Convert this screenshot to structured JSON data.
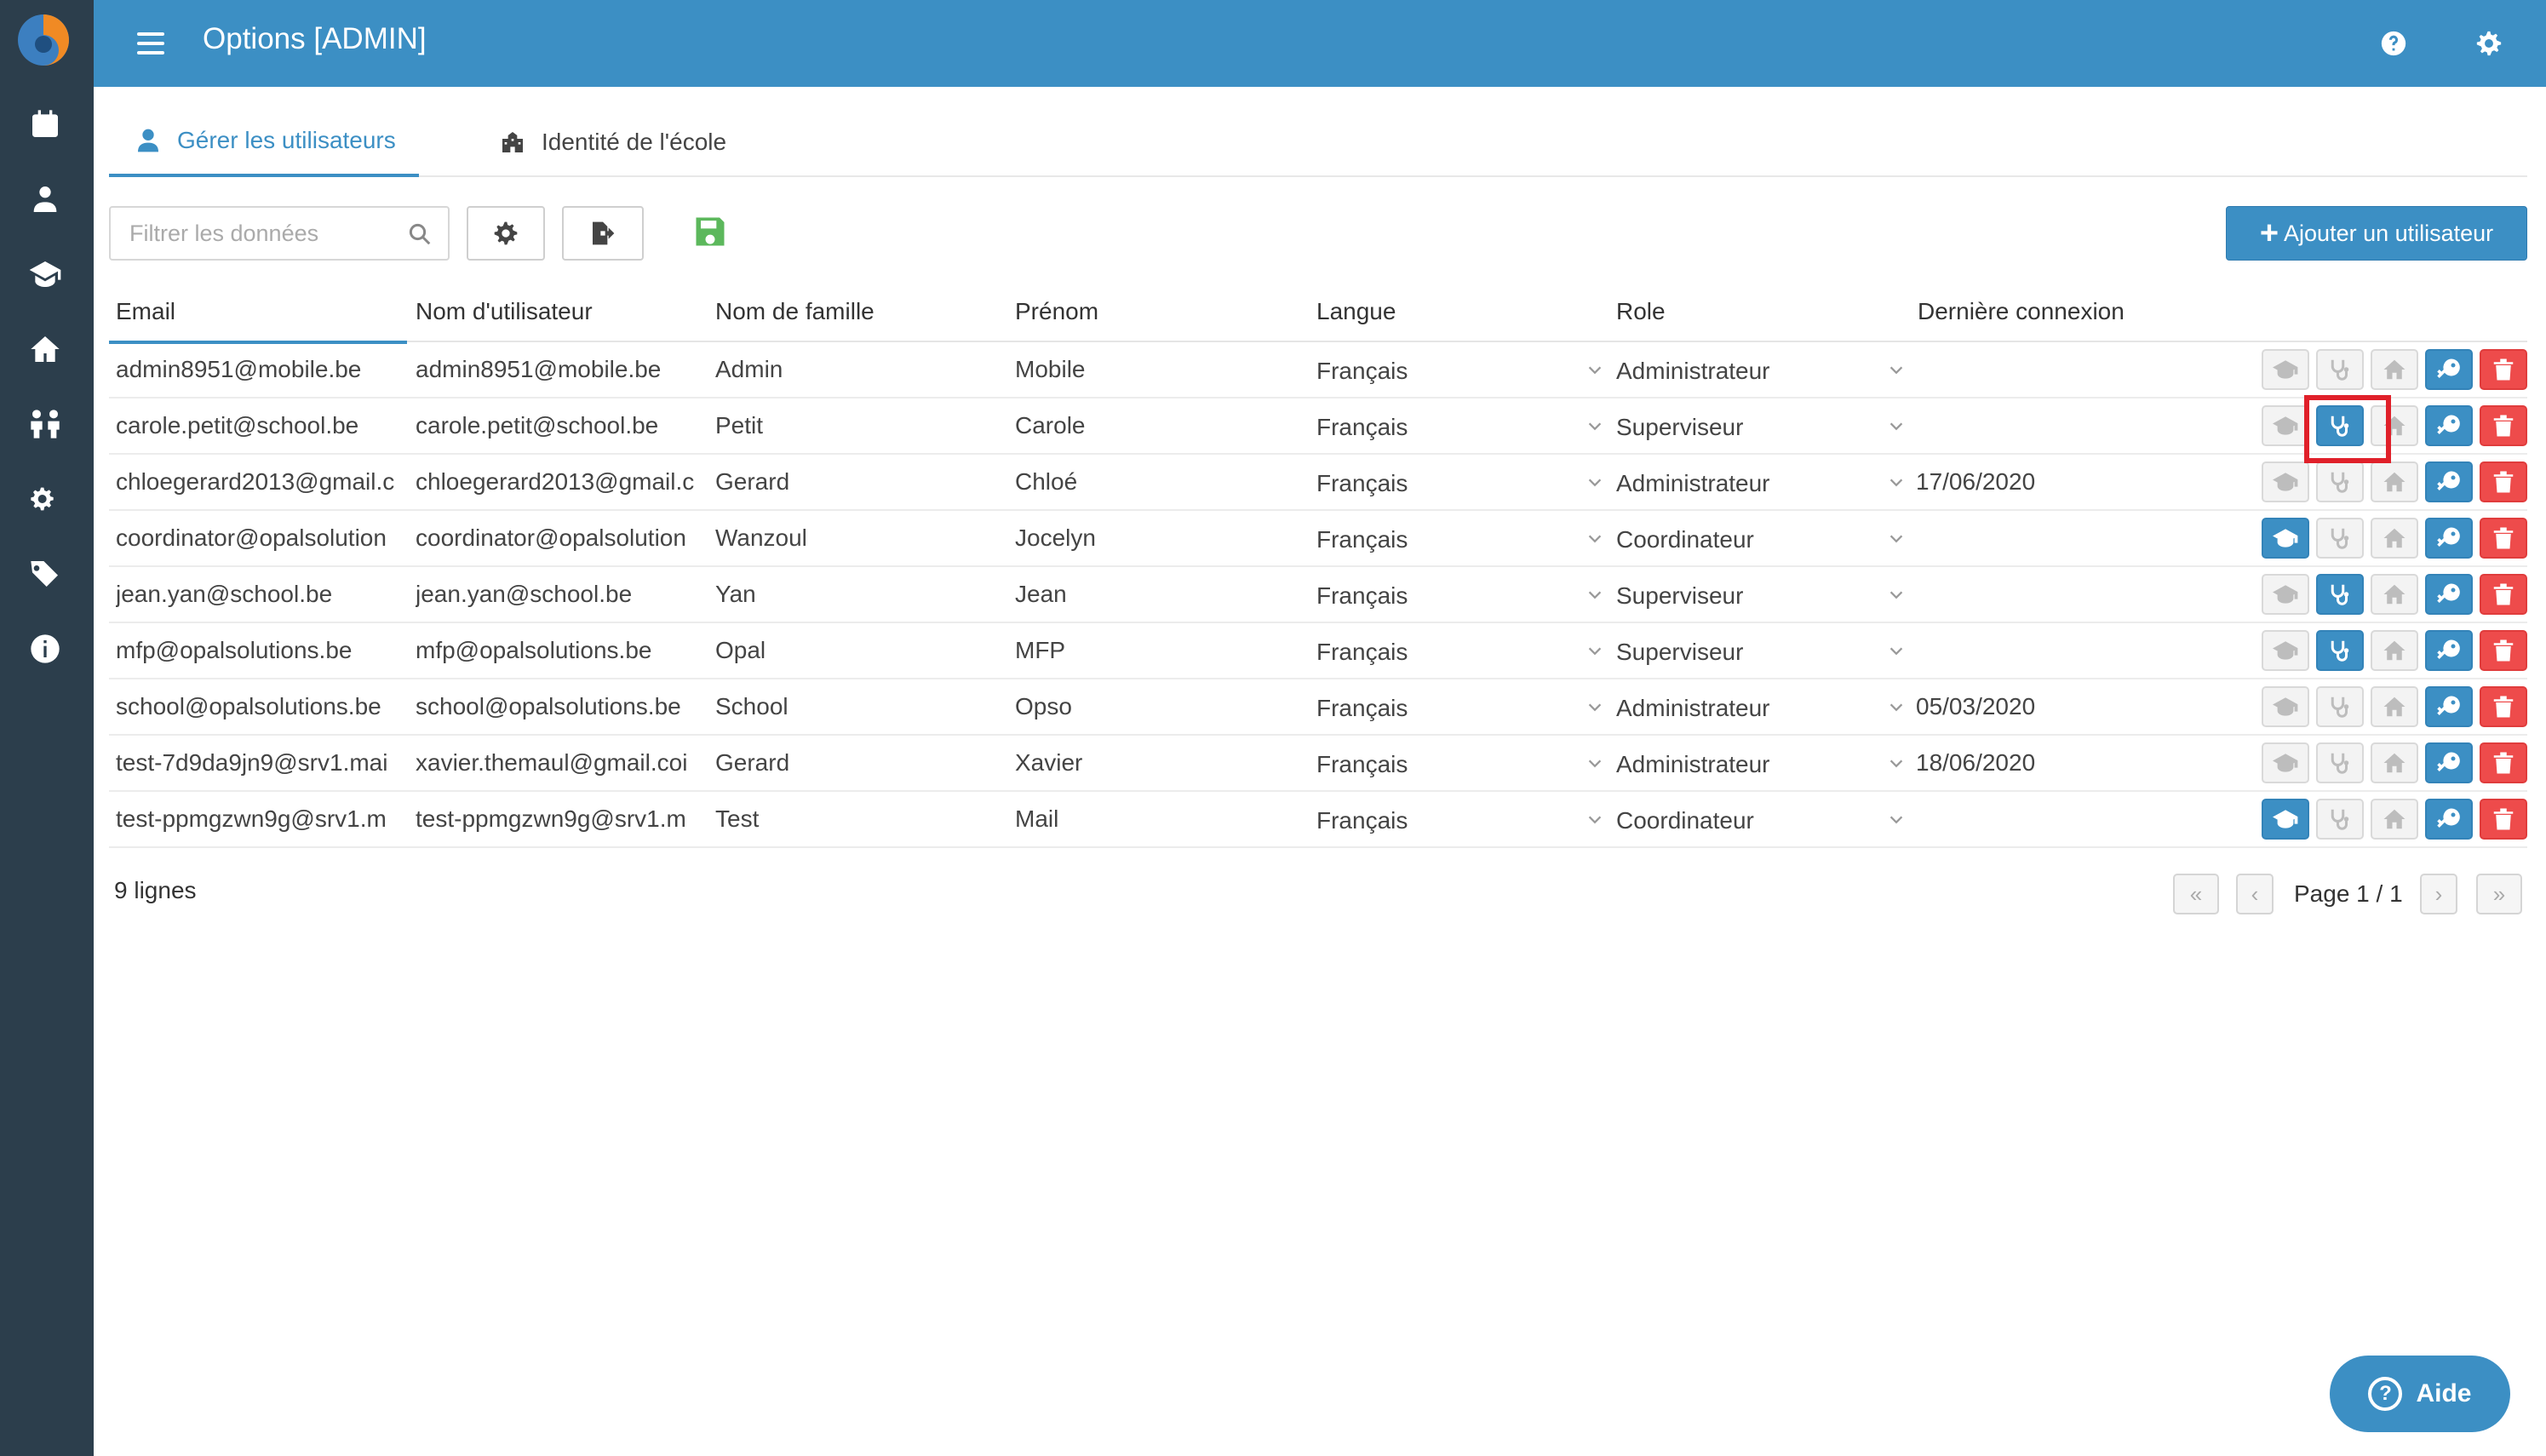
{
  "header": {
    "title": "Options [ADMIN]",
    "help_icon": "question-circle-icon",
    "settings_icon": "gear-icon"
  },
  "sidebar": {
    "logo": "app-logo",
    "items": [
      {
        "icon": "calendar-icon"
      },
      {
        "icon": "teacher-icon"
      },
      {
        "icon": "graduation-cap-icon"
      },
      {
        "icon": "home-icon"
      },
      {
        "icon": "people-icon"
      },
      {
        "icon": "gears-icon"
      },
      {
        "icon": "tags-icon"
      },
      {
        "icon": "info-icon"
      }
    ]
  },
  "tabs": [
    {
      "label": "Gérer les utilisateurs",
      "icon": "user-icon",
      "active": true
    },
    {
      "label": "Identité de l'école",
      "icon": "school-icon",
      "active": false
    }
  ],
  "toolbar": {
    "search_placeholder": "Filtrer les données",
    "add_label": "Ajouter un utilisateur"
  },
  "table": {
    "headers": [
      "Email",
      "Nom d'utilisateur",
      "Nom de famille",
      "Prénom",
      "Langue",
      "Role",
      "Dernière connexion"
    ],
    "rows": [
      {
        "email": "admin8951@mobile.be",
        "username": "admin8951@mobile.be",
        "lastname": "Admin",
        "firstname": "Mobile",
        "lang": "Français",
        "role": "Administrateur",
        "last": "",
        "active": [
          false,
          false,
          false
        ]
      },
      {
        "email": "carole.petit@school.be",
        "username": "carole.petit@school.be",
        "lastname": "Petit",
        "firstname": "Carole",
        "lang": "Français",
        "role": "Superviseur",
        "last": "",
        "active": [
          false,
          true,
          false
        ]
      },
      {
        "email": "chloegerard2013@gmail.c",
        "username": "chloegerard2013@gmail.c",
        "lastname": "Gerard",
        "firstname": "Chloé",
        "lang": "Français",
        "role": "Administrateur",
        "last": "17/06/2020",
        "active": [
          false,
          false,
          false
        ]
      },
      {
        "email": "coordinator@opalsolution",
        "username": "coordinator@opalsolution",
        "lastname": "Wanzoul",
        "firstname": "Jocelyn",
        "lang": "Français",
        "role": "Coordinateur",
        "last": "",
        "active": [
          true,
          false,
          false
        ]
      },
      {
        "email": "jean.yan@school.be",
        "username": "jean.yan@school.be",
        "lastname": "Yan",
        "firstname": "Jean",
        "lang": "Français",
        "role": "Superviseur",
        "last": "",
        "active": [
          false,
          true,
          false
        ]
      },
      {
        "email": "mfp@opalsolutions.be",
        "username": "mfp@opalsolutions.be",
        "lastname": "Opal",
        "firstname": "MFP",
        "lang": "Français",
        "role": "Superviseur",
        "last": "",
        "active": [
          false,
          true,
          false
        ]
      },
      {
        "email": "school@opalsolutions.be",
        "username": "school@opalsolutions.be",
        "lastname": "School",
        "firstname": "Opso",
        "lang": "Français",
        "role": "Administrateur",
        "last": "05/03/2020",
        "active": [
          false,
          false,
          false
        ]
      },
      {
        "email": "test-7d9da9jn9@srv1.mai",
        "username": "xavier.themaul@gmail.coi",
        "lastname": "Gerard",
        "firstname": "Xavier",
        "lang": "Français",
        "role": "Administrateur",
        "last": "18/06/2020",
        "active": [
          false,
          false,
          false
        ]
      },
      {
        "email": "test-ppmgzwn9g@srv1.m",
        "username": "test-ppmgzwn9g@srv1.m",
        "lastname": "Test",
        "firstname": "Mail",
        "lang": "Français",
        "role": "Coordinateur",
        "last": "",
        "active": [
          true,
          false,
          false
        ]
      }
    ]
  },
  "footer": {
    "count": "9 lignes",
    "page": "Page 1 / 1"
  },
  "help_button": {
    "label": "Aide"
  },
  "colors": {
    "primary": "#3c8fc4",
    "sidebar": "#2c3e4c",
    "danger": "#ee4b4b",
    "save": "#5cb85c",
    "highlight": "#e0202a"
  }
}
